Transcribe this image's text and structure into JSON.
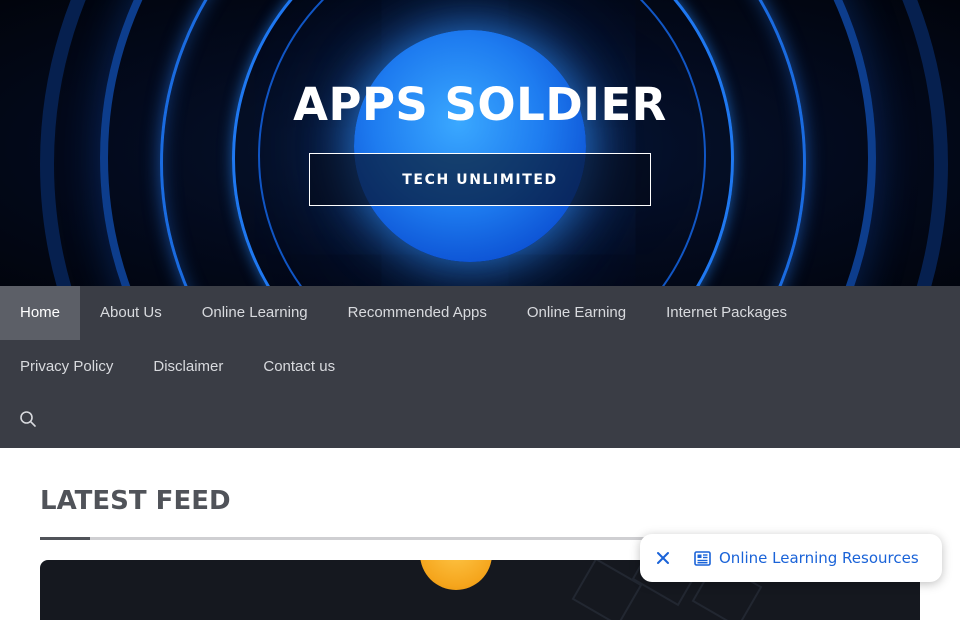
{
  "header": {
    "site_title": "APPS SOLDIER",
    "tagline": "TECH UNLIMITED"
  },
  "nav": {
    "row1": [
      {
        "label": "Home",
        "active": true
      },
      {
        "label": "About Us"
      },
      {
        "label": "Online Learning"
      },
      {
        "label": "Recommended Apps"
      },
      {
        "label": "Online Earning"
      },
      {
        "label": "Internet Packages"
      }
    ],
    "row2": [
      {
        "label": "Privacy Policy"
      },
      {
        "label": "Disclaimer"
      },
      {
        "label": "Contact us"
      }
    ],
    "search_icon": "search-icon"
  },
  "main": {
    "section_title": "LATEST FEED"
  },
  "floating_chip": {
    "label": "Online Learning Resources",
    "icon": "newspaper-icon",
    "close_icon": "close-icon"
  },
  "colors": {
    "nav_bg": "#3a3d45",
    "nav_active_bg": "#5c5f67",
    "chip_text": "#1a63d8",
    "title_text": "#505359"
  }
}
